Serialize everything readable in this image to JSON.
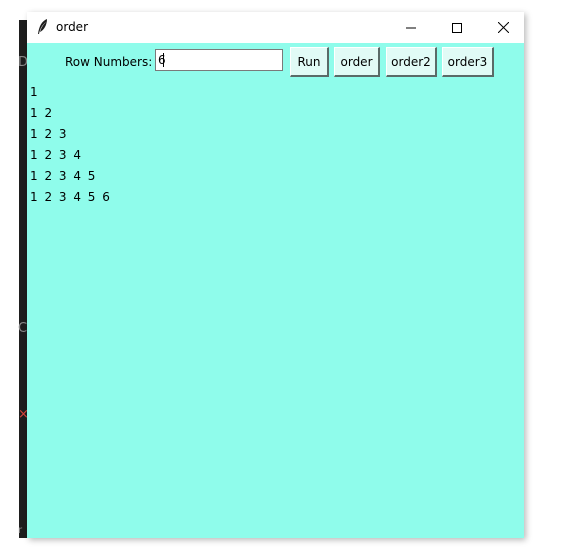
{
  "window": {
    "title": "order",
    "app_icon": "feather-icon",
    "controls": {
      "minimize": "minimize-icon",
      "maximize": "maximize-icon",
      "close": "close-icon"
    }
  },
  "form": {
    "row_label": "Row Numbers:",
    "row_value": "6"
  },
  "buttons": {
    "run": "Run",
    "order": "order",
    "order2": "order2",
    "order3": "order3"
  },
  "output": {
    "rows": [
      "1",
      "1 2",
      "1 2 3",
      "1 2 3 4",
      "1 2 3 4 5",
      "1 2 3 4 5 6"
    ]
  },
  "background": {
    "glyphs": [
      "D",
      "C",
      "×",
      "r"
    ]
  },
  "colors": {
    "window_bg": "#8ffceb",
    "button_bg": "#e1fbf6",
    "titlebar_bg": "#ffffff"
  }
}
